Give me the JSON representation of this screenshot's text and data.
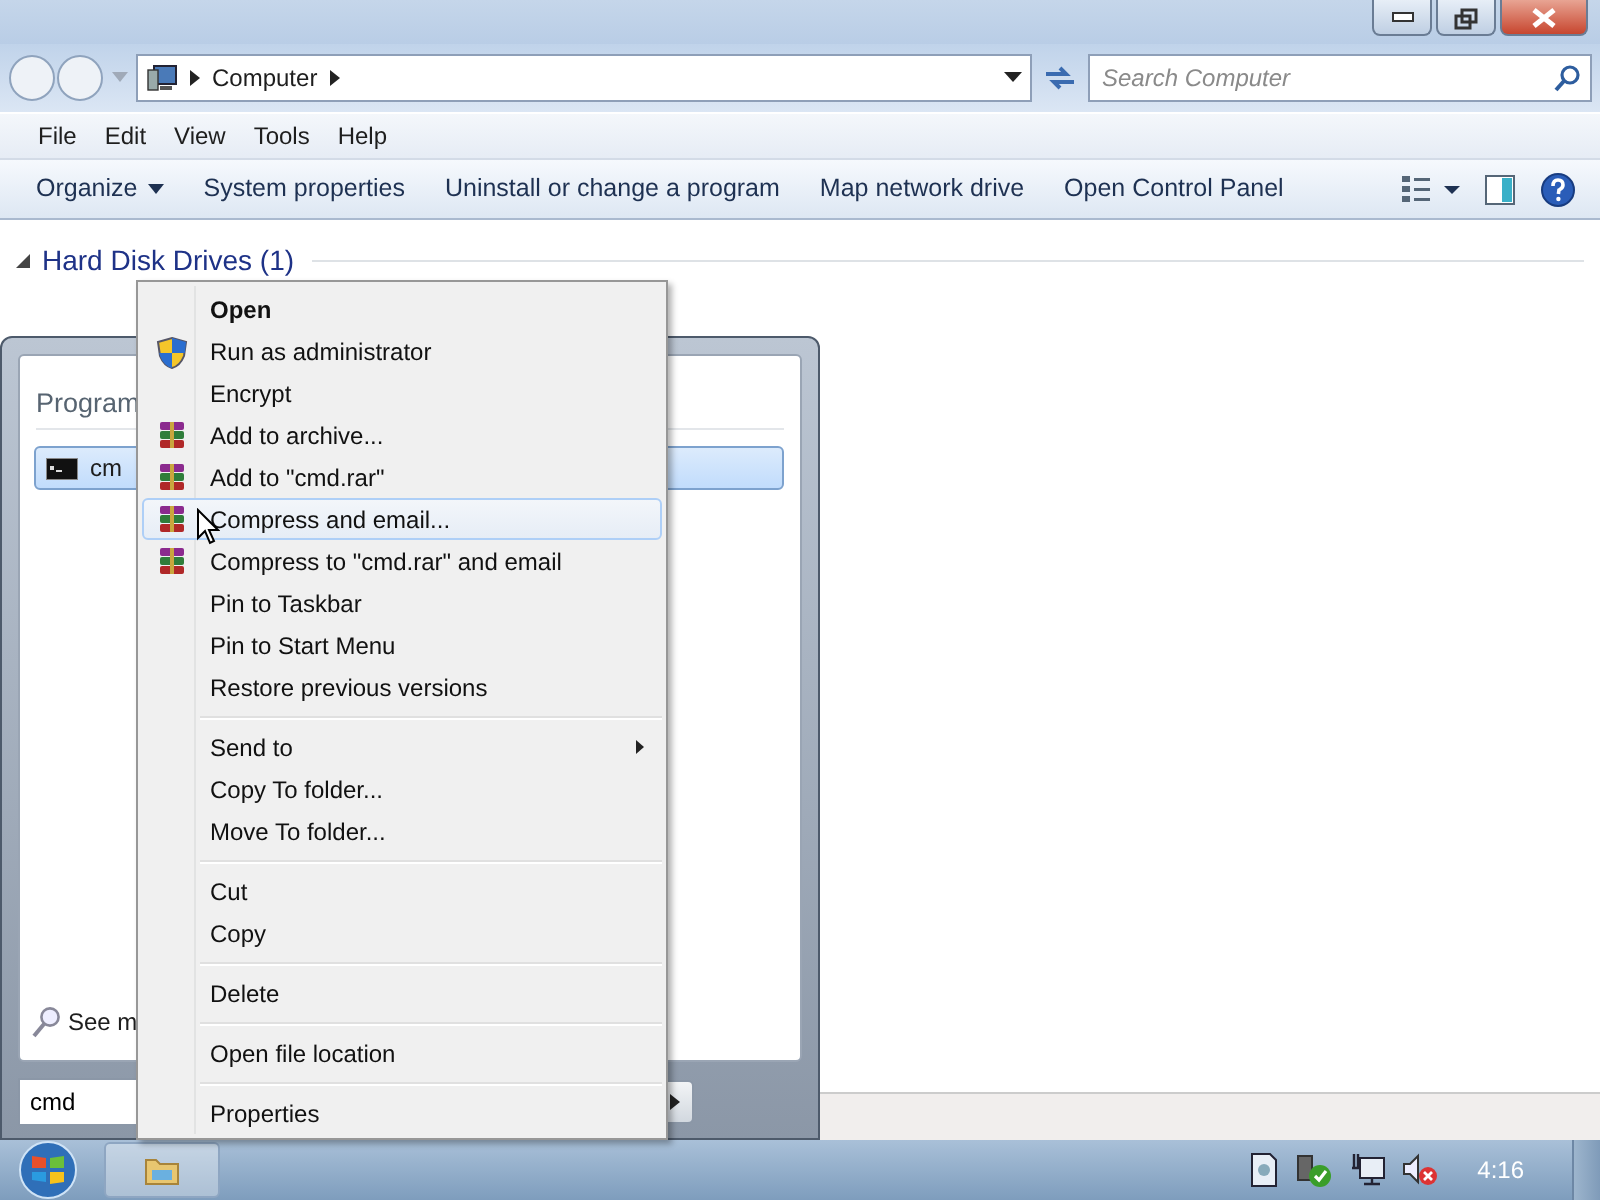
{
  "address_bar": {
    "crumbs": [
      "Computer"
    ]
  },
  "search": {
    "placeholder": "Search Computer"
  },
  "menu_bar": [
    "File",
    "Edit",
    "View",
    "Tools",
    "Help"
  ],
  "command_bar": [
    {
      "label": "Organize",
      "kind": "dropdown"
    },
    {
      "label": "System properties",
      "kind": "plain"
    },
    {
      "label": "Uninstall or change a program",
      "kind": "plain"
    },
    {
      "label": "Map network drive",
      "kind": "plain"
    },
    {
      "label": "Open Control Panel",
      "kind": "plain"
    }
  ],
  "section": {
    "heading": "Hard Disk Drives (1)",
    "expanded": true
  },
  "start_menu": {
    "group_heading": "Program",
    "results": [
      {
        "label": "cm",
        "selected": true
      }
    ],
    "see_more": "See m",
    "search": {
      "value": "cmd"
    }
  },
  "context_menu": [
    {
      "kind": "item",
      "label": "Open",
      "default": true,
      "selected": false
    },
    {
      "kind": "shield_item",
      "label": "Run as administrator",
      "default": false,
      "selected": false
    },
    {
      "kind": "item",
      "label": "Encrypt",
      "default": false,
      "selected": false
    },
    {
      "kind": "archive_item",
      "label": "Add to archive...",
      "default": false,
      "selected": false
    },
    {
      "kind": "archive_item",
      "label": "Add to \"cmd.rar\"",
      "default": false,
      "selected": false
    },
    {
      "kind": "archive_item",
      "label": "Compress and email...",
      "default": false,
      "selected": true
    },
    {
      "kind": "archive_item",
      "label": "Compress to \"cmd.rar\" and email",
      "default": false,
      "selected": false
    },
    {
      "kind": "item",
      "label": "Pin to Taskbar",
      "default": false,
      "selected": false
    },
    {
      "kind": "item",
      "label": "Pin to Start Menu",
      "default": false,
      "selected": false
    },
    {
      "kind": "item",
      "label": "Restore previous versions",
      "default": false,
      "selected": false
    },
    {
      "kind": "separator"
    },
    {
      "kind": "item",
      "label": "Send to",
      "submenu": true,
      "default": false,
      "selected": false
    },
    {
      "kind": "item",
      "label": "Copy To folder...",
      "default": false,
      "selected": false
    },
    {
      "kind": "item",
      "label": "Move To folder...",
      "default": false,
      "selected": false
    },
    {
      "kind": "separator"
    },
    {
      "kind": "item",
      "label": "Cut",
      "default": false,
      "selected": false
    },
    {
      "kind": "item",
      "label": "Copy",
      "default": false,
      "selected": false
    },
    {
      "kind": "separator"
    },
    {
      "kind": "item",
      "label": "Delete",
      "default": false,
      "selected": false
    },
    {
      "kind": "separator"
    },
    {
      "kind": "item",
      "label": "Open file location",
      "default": false,
      "selected": false
    },
    {
      "kind": "separator"
    },
    {
      "kind": "item",
      "label": "Properties",
      "default": false,
      "selected": false
    }
  ],
  "taskbar": {
    "clock": "4:16"
  }
}
